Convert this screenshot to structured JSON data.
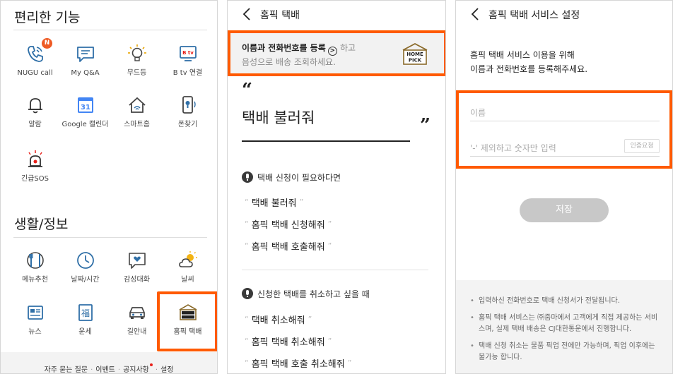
{
  "panel1": {
    "section1_title": "편리한 기능",
    "section2_title": "생활/정보",
    "badge": "N",
    "features": [
      {
        "label": "NUGU call",
        "icon": "phone-call-icon"
      },
      {
        "label": "My Q&A",
        "icon": "chat-icon"
      },
      {
        "label": "무드등",
        "icon": "light-bulb-icon"
      },
      {
        "label": "B tv 연결",
        "icon": "tv-icon"
      },
      {
        "label": "알람",
        "icon": "bell-icon"
      },
      {
        "label": "Google 캘린더",
        "icon": "google-calendar-icon"
      },
      {
        "label": "스마트홈",
        "icon": "smart-home-icon"
      },
      {
        "label": "폰찾기",
        "icon": "find-phone-icon"
      },
      {
        "label": "긴급SOS",
        "icon": "siren-icon"
      }
    ],
    "calendar_number": "31",
    "tv_label": "B tv",
    "life": [
      {
        "label": "메뉴추천",
        "icon": "dining-icon"
      },
      {
        "label": "날짜/시간",
        "icon": "clock-icon"
      },
      {
        "label": "감성대화",
        "icon": "heart-chat-icon"
      },
      {
        "label": "날씨",
        "icon": "weather-icon"
      },
      {
        "label": "뉴스",
        "icon": "news-icon"
      },
      {
        "label": "운세",
        "icon": "fortune-icon"
      },
      {
        "label": "길안내",
        "icon": "car-icon"
      },
      {
        "label": "홈픽 택배",
        "icon": "homepick-icon"
      }
    ],
    "fortune_char": "福",
    "footer": [
      "자주 묻는 질문",
      "이벤트",
      "공지사항",
      "설정"
    ],
    "accent_color": "#ff5a00"
  },
  "panel2": {
    "title": "홈픽 택배",
    "banner_bold": "이름과 전화번호를 등록",
    "banner_rest": "하고",
    "banner_line2": "음성으로 배송 조회하세요.",
    "logo_line1": "HOME",
    "logo_line2": "PICK",
    "quote_open": "“",
    "quote_close": "”",
    "main_command": "택배 불러줘",
    "section1": "택배 신청이 필요하다면",
    "examples1": [
      "택배 불러줘",
      "홈픽 택배 신청해줘",
      "홈픽 택배 호출해줘"
    ],
    "section2": "신청한 택배를 취소하고 싶을 때",
    "examples2": [
      "택배 취소해줘",
      "홈픽 택배 취소해줘",
      "홈픽 택배 호출 취소해줘"
    ],
    "quote_left": "“",
    "quote_right": "”"
  },
  "panel3": {
    "title": "홈픽 택배 서비스 설정",
    "intro_line1": "홈픽 택배 서비스 이용을 위해",
    "intro_line2": "이름과 전화번호를 등록해주세요.",
    "name_placeholder": "이름",
    "phone_placeholder": "'-' 제외하고 숫자만 입력",
    "cert_button": "인증요청",
    "save_button": "저장",
    "notices": [
      "입력하신 전화번호로 택배 신청서가 전달됩니다.",
      "홈픽 택배 서비스는 ㈜줌마에서 고객에게 직접 제공하는 서비스며, 실제 택배 배송은 CJ대한통운에서 진행합니다.",
      "택배 신청 취소는 물품 픽업 전에만 가능하며, 픽업 이후에는 불가능 합니다."
    ]
  }
}
